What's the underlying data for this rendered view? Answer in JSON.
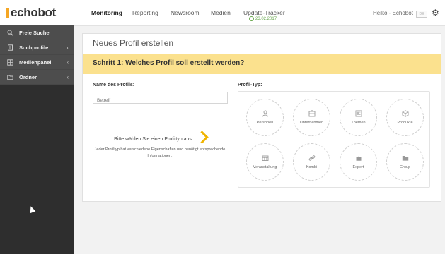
{
  "app": {
    "logo_text": "echobot"
  },
  "topnav": {
    "items": [
      {
        "label": "Monitoring",
        "active": true
      },
      {
        "label": "Reporting"
      },
      {
        "label": "Newsroom"
      },
      {
        "label": "Medien"
      },
      {
        "label": "Update-Tracker"
      }
    ],
    "tracker_date": "23.02.2017",
    "user": "Heiko - Echobot",
    "flag_label": "DE"
  },
  "sidebar": {
    "items": [
      {
        "label": "Freie Suche",
        "icon": "search-icon"
      },
      {
        "label": "Suchprofile",
        "icon": "document-icon",
        "has_chevron": true
      },
      {
        "label": "Medienpanel",
        "icon": "grid-icon",
        "has_chevron": true
      },
      {
        "label": "Ordner",
        "icon": "folder-icon",
        "has_chevron": true
      }
    ]
  },
  "panel": {
    "title": "Neues Profil erstellen",
    "step": "Schritt 1: Welches Profil soll erstellt werden?",
    "name_label": "Name des Profils:",
    "name_placeholder": "Betreff",
    "type_label": "Profil-Typ:",
    "hint_main": "Bitte wählen Sie einen Profiltyp aus.",
    "hint_sub": "Jeder Profiltyp hat verschiedene Eigenschaften und benötigt entsprechende Informationen.",
    "types": [
      {
        "label": "Personen",
        "icon": "person-icon"
      },
      {
        "label": "Unternehmen",
        "icon": "building-icon"
      },
      {
        "label": "Themen",
        "icon": "newspaper-icon"
      },
      {
        "label": "Produkte",
        "icon": "box-icon"
      },
      {
        "label": "Veranstaltung",
        "icon": "calendar-icon"
      },
      {
        "label": "Kombi",
        "icon": "link-icon"
      },
      {
        "label": "Expert",
        "icon": "puzzle-icon"
      },
      {
        "label": "Group",
        "icon": "folder-icon"
      }
    ]
  },
  "colors": {
    "accent": "#fbe18e",
    "sidebar": "#2e2e2e",
    "arrow": "#f0b400"
  }
}
